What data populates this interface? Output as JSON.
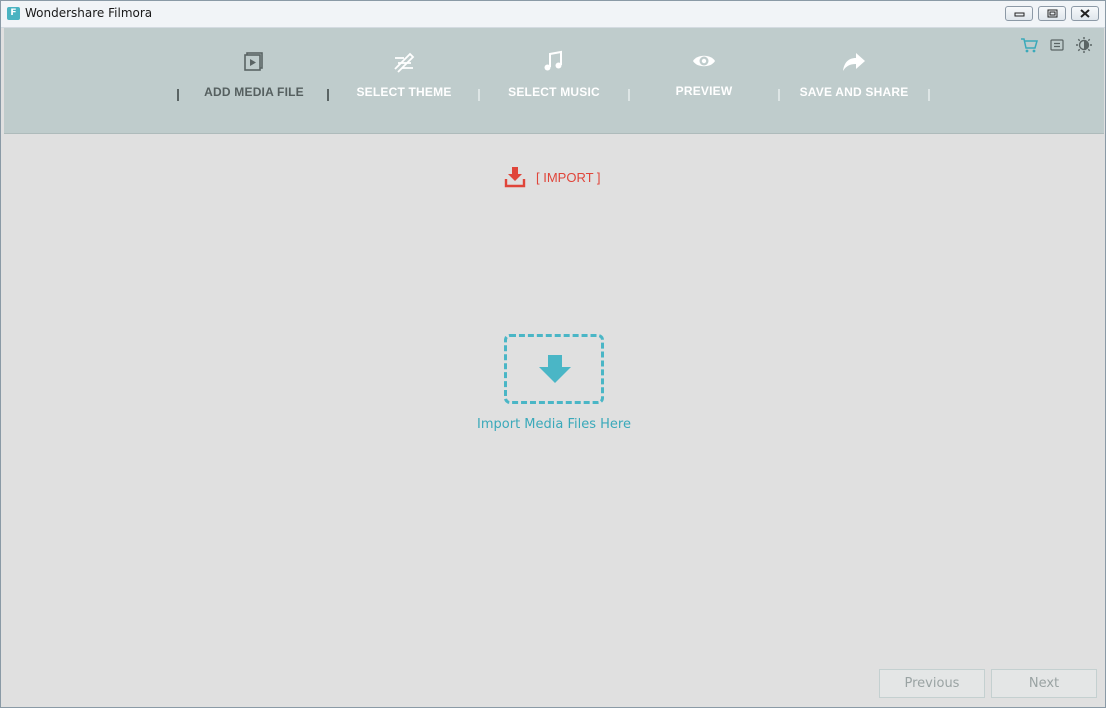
{
  "window": {
    "title": "Wondershare Filmora",
    "app_icon_letter": "F"
  },
  "toolbar": {
    "steps": [
      {
        "label": "ADD MEDIA FILE",
        "icon": "media-file-icon",
        "active": true
      },
      {
        "label": "SELECT THEME",
        "icon": "theme-icon",
        "active": false
      },
      {
        "label": "SELECT MUSIC",
        "icon": "music-note-icon",
        "active": false
      },
      {
        "label": "PREVIEW",
        "icon": "eye-icon",
        "active": false
      },
      {
        "label": "SAVE AND SHARE",
        "icon": "share-arrow-icon",
        "active": false
      }
    ],
    "right_icons": [
      "cart-icon",
      "menu-icon",
      "brightness-icon"
    ]
  },
  "main": {
    "import_label": "[ IMPORT ]",
    "drop_label": "Import Media Files Here"
  },
  "footer": {
    "previous_label": "Previous",
    "next_label": "Next"
  },
  "colors": {
    "toolbar_bg": "#bfcccc",
    "import_red": "#e0453a",
    "accent_teal": "#4ab6c6",
    "content_bg": "#e0e0e0"
  }
}
